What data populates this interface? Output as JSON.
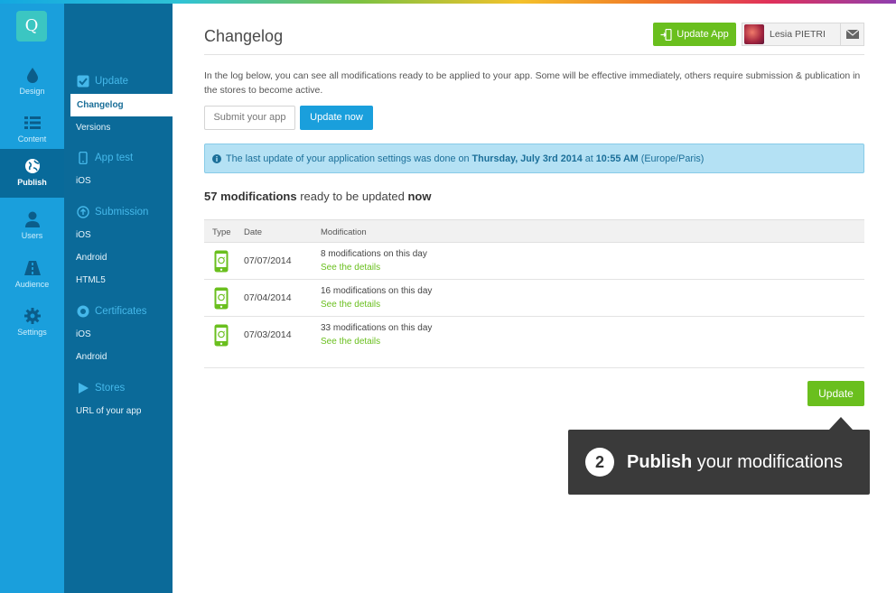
{
  "rail": {
    "logo": "Q",
    "items": [
      {
        "label": "Design",
        "icon": "drop-icon"
      },
      {
        "label": "Content",
        "icon": "list-icon"
      },
      {
        "label": "Publish",
        "icon": "globe-icon"
      },
      {
        "label": "Users",
        "icon": "user-icon"
      },
      {
        "label": "Audience",
        "icon": "road-icon"
      },
      {
        "label": "Settings",
        "icon": "gear-icon"
      }
    ]
  },
  "subnav": {
    "update": {
      "title": "Update",
      "items": [
        "Changelog",
        "Versions"
      ]
    },
    "apptest": {
      "title": "App test",
      "items": [
        "iOS"
      ]
    },
    "submission": {
      "title": "Submission",
      "items": [
        "iOS",
        "Android",
        "HTML5"
      ]
    },
    "certificates": {
      "title": "Certificates",
      "items": [
        "iOS",
        "Android"
      ]
    },
    "stores": {
      "title": "Stores",
      "items": [
        "URL of your app"
      ]
    }
  },
  "header": {
    "title": "Changelog",
    "update_app_label": "Update App",
    "user_name": "Lesia PIETRI"
  },
  "intro": "In the log below, you can see all modifications ready to be applied to your app. Some will be effective immediately, others require submission & publication in the stores to become active.",
  "buttons": {
    "submit": "Submit your app",
    "update_now": "Update now",
    "update": "Update"
  },
  "info": {
    "prefix": "The last update of your application settings was done on ",
    "date": "Thursday, July 3rd 2014",
    "at": " at ",
    "time": "10:55 AM",
    "tz": " (Europe/Paris)"
  },
  "count": {
    "number": "57 modifications",
    "middle": " ready to be updated ",
    "when": "now"
  },
  "table": {
    "headers": {
      "type": "Type",
      "date": "Date",
      "modification": "Modification"
    },
    "rows": [
      {
        "date": "07/07/2014",
        "mod": "8 modifications on this day",
        "link": "See the details"
      },
      {
        "date": "07/04/2014",
        "mod": "16 modifications on this day",
        "link": "See the details"
      },
      {
        "date": "07/03/2014",
        "mod": "33 modifications on this day",
        "link": "See the details"
      }
    ]
  },
  "tooltip": {
    "number": "2",
    "bold": "Publish",
    "rest": " your modifications"
  },
  "colors": {
    "rail": "#1a9fdc",
    "subnav": "#0b6a99",
    "green": "#6abf1e",
    "info_bg": "#b4e1f4"
  }
}
